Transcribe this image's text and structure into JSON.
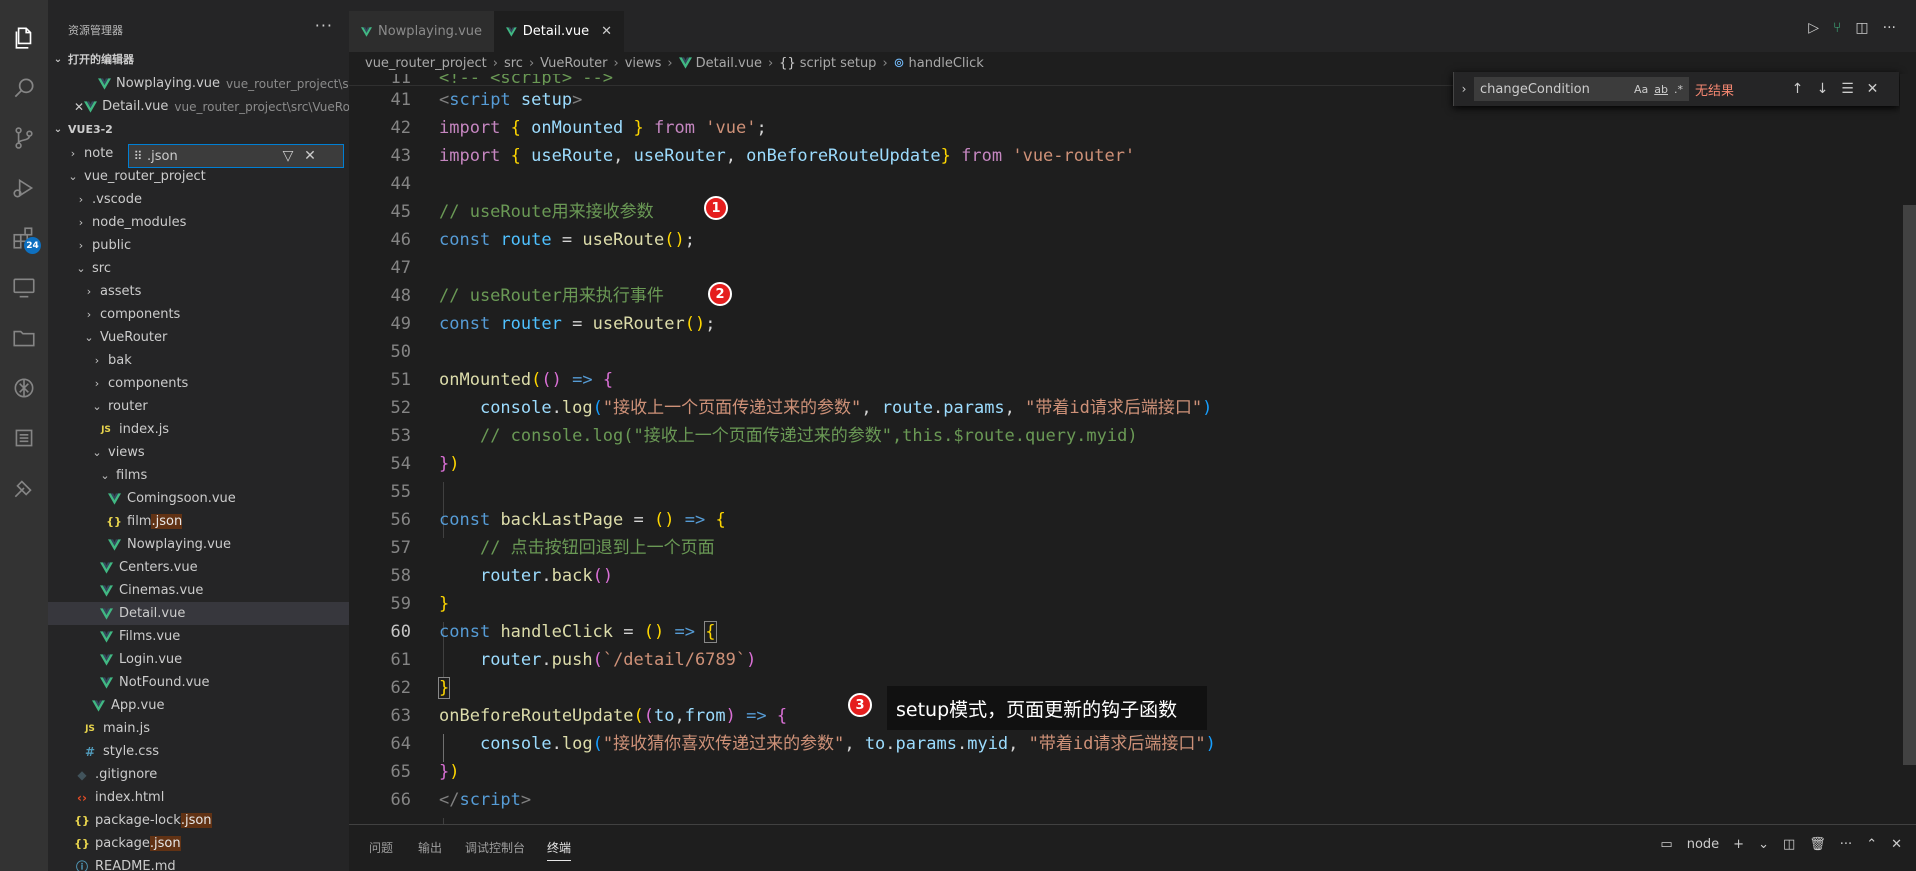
{
  "sidebar": {
    "title": "资源管理器",
    "more": "···",
    "open_editors_label": "打开的编辑器",
    "open_editors": [
      {
        "name": "Nowplaying.vue",
        "path": "vue_router_project\\src..."
      },
      {
        "name": "Detail.vue",
        "path": "vue_router_project\\src\\VueRo..."
      }
    ],
    "workspace_label": "VUE3-2",
    "filter_value": ".json",
    "tree": {
      "note": "note",
      "vue_router_project": "vue_router_project",
      "vscode": ".vscode",
      "node_modules": "node_modules",
      "public": "public",
      "src": "src",
      "assets": "assets",
      "components": "components",
      "VueRouter": "VueRouter",
      "bak": "bak",
      "components2": "components",
      "router": "router",
      "index_js": "index.js",
      "views": "views",
      "films": "films",
      "comingsoon": "Comingsoon.vue",
      "film_json_a": "film",
      "film_json_b": ".json",
      "nowplaying": "Nowplaying.vue",
      "centers": "Centers.vue",
      "cinemas": "Cinemas.vue",
      "detail": "Detail.vue",
      "films_vue": "Films.vue",
      "login": "Login.vue",
      "notfound": "NotFound.vue",
      "app": "App.vue",
      "main_js": "main.js",
      "style_css": "style.css",
      "gitignore": ".gitignore",
      "index_html": "index.html",
      "package_lock_a": "package-lock",
      "package_lock_b": ".json",
      "package_a": "package",
      "package_b": ".json",
      "readme": "README.md"
    }
  },
  "activity_bar": {
    "extensions_badge": "24"
  },
  "tabs": [
    {
      "label": "Nowplaying.vue",
      "active": false
    },
    {
      "label": "Detail.vue",
      "active": true,
      "close": "✕"
    }
  ],
  "breadcrumb": [
    "vue_router_project",
    "src",
    "VueRouter",
    "views",
    "Detail.vue",
    "script setup",
    "handleClick"
  ],
  "find_widget": {
    "query": "changeCondition",
    "match_case": "Aa",
    "whole_word": "ab",
    "regex": ".*",
    "result": "无结果"
  },
  "editor": {
    "sticky_line_number": "11",
    "sticky_text": "<!-- <script> -->",
    "line_numbers": [
      "41",
      "42",
      "43",
      "44",
      "45",
      "46",
      "47",
      "48",
      "49",
      "50",
      "51",
      "52",
      "53",
      "54",
      "55",
      "56",
      "57",
      "58",
      "59",
      "60",
      "61",
      "62",
      "63",
      "64",
      "65",
      "66"
    ],
    "current_line": "60",
    "code": {
      "l41_a": "<",
      "l41_b": "script",
      "l41_c": "setup",
      "l41_d": ">",
      "l42_a": "import",
      "l42_b": "{",
      "l42_c": "onMounted",
      "l42_d": "}",
      "l42_e": "from",
      "l42_f": "'vue'",
      "l42_g": ";",
      "l43_a": "import",
      "l43_b": "{",
      "l43_c": "useRoute",
      "l43_d": ",",
      "l43_e": "useRouter",
      "l43_f": "onBeforeRouteUpdate",
      "l43_g": "}",
      "l43_h": "from",
      "l43_i": "'vue-router'",
      "l45": "// useRoute用来接收参数",
      "l46_a": "const",
      "l46_b": "route",
      "l46_c": "=",
      "l46_d": "useRoute",
      "l46_e": "()",
      "l46_f": ";",
      "l48": "// useRouter用来执行事件",
      "l49_a": "const",
      "l49_b": "router",
      "l49_c": "=",
      "l49_d": "useRouter",
      "l49_e": "()",
      "l49_f": ";",
      "l51_a": "onMounted",
      "l51_b": "(",
      "l51_c": "()",
      "l51_d": "=>",
      "l51_e": "{",
      "l52_a": "console",
      "l52_b": ".",
      "l52_c": "log",
      "l52_d": "(",
      "l52_e": "\"接收上一个页面传递过来的参数\"",
      "l52_f": ",",
      "l52_g": "route",
      "l52_h": "params",
      "l52_i": "\"带着id请求后端接口\"",
      "l52_j": ")",
      "l53": "// console.log(\"接收上一个页面传递过来的参数\",this.$route.query.myid)",
      "l54_a": "}",
      "l54_b": ")",
      "l56_a": "const",
      "l56_b": "backLastPage",
      "l56_c": "=",
      "l56_d": "()",
      "l56_e": "=>",
      "l56_f": "{",
      "l57": "// 点击按钮回退到上一个页面",
      "l58_a": "router",
      "l58_b": ".",
      "l58_c": "back",
      "l58_d": "()",
      "l59": "}",
      "l60_a": "const",
      "l60_b": "handleClick",
      "l60_c": "=",
      "l60_d": "()",
      "l60_e": "=>",
      "l60_f": "{",
      "l61_a": "router",
      "l61_b": ".",
      "l61_c": "push",
      "l61_d": "(",
      "l61_e": "`/detail/6789`",
      "l61_f": ")",
      "l62": "}",
      "l63_a": "onBeforeRouteUpdate",
      "l63_b": "(",
      "l63_c": "(",
      "l63_d": "to",
      "l63_e": ",",
      "l63_f": "from",
      "l63_g": ")",
      "l63_h": "=>",
      "l63_i": "{",
      "l64_a": "console",
      "l64_b": ".",
      "l64_c": "log",
      "l64_d": "(",
      "l64_e": "\"接收猜你喜欢传递过来的参数\"",
      "l64_f": ",",
      "l64_g": "to",
      "l64_h": "params",
      "l64_i": "myid",
      "l64_j": "\"带着id请求后端接口\"",
      "l64_k": ")",
      "l65_a": "}",
      "l65_b": ")",
      "l66_a": "</",
      "l66_b": "script",
      "l66_c": ">"
    }
  },
  "annotations": {
    "badge1": "1",
    "badge2": "2",
    "badge3": "3",
    "tooltip": "setup模式，页面更新的钩子函数"
  },
  "panel": {
    "tabs": [
      "问题",
      "输出",
      "调试控制台",
      "终端"
    ],
    "active_tab": "终端",
    "terminal_name": "node"
  },
  "colors": {
    "accent": "#007fd4",
    "badge_red": "#e51e1e",
    "vue_green": "#41b883"
  }
}
